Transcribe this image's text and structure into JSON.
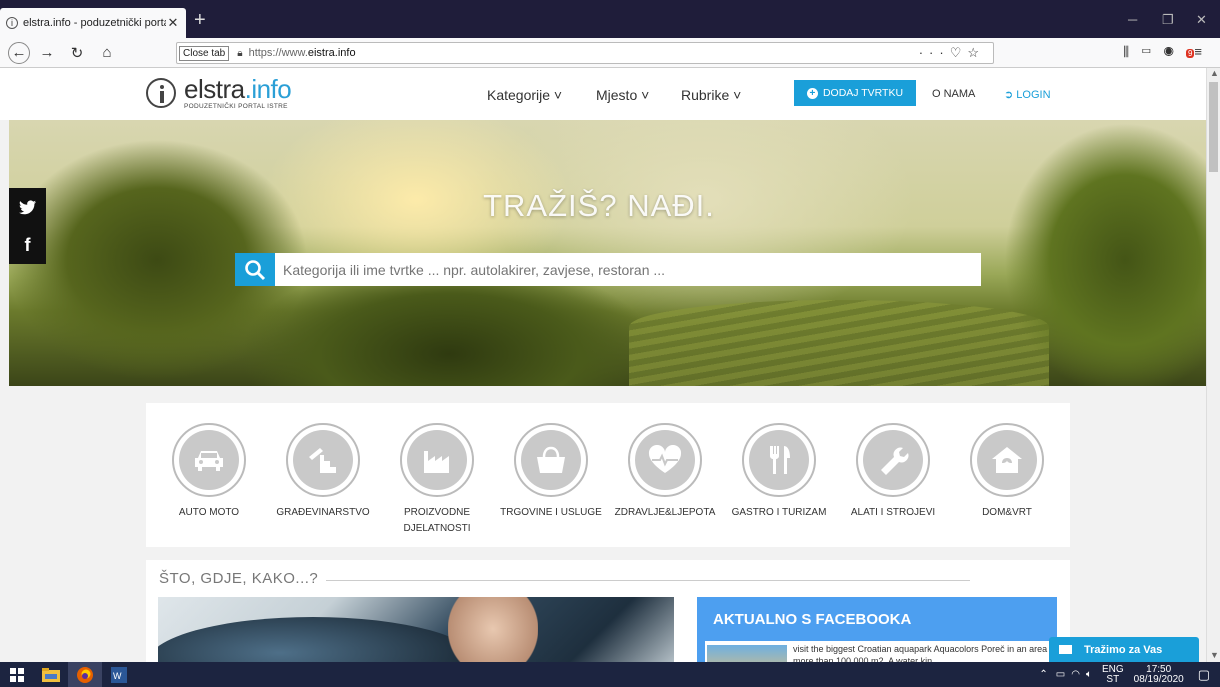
{
  "browser": {
    "tab_title": "elstra.info - poduzetnički porta",
    "tab_close_tooltip": "Close tab",
    "url_prefix": "https://www.",
    "url_domain": "eistra.info",
    "url_menu_glyph": "···",
    "new_tab_glyph": "+"
  },
  "site": {
    "logo_name": "elstra",
    "logo_tld": "info",
    "logo_subtitle": "PODUZETNIČKI PORTAL ISTRE",
    "nav": [
      {
        "label": "Kategorije ˅"
      },
      {
        "label": "Mjesto ˅"
      },
      {
        "label": "Rubrike ˅"
      }
    ],
    "add_business": "DODAJ TVRTKU",
    "about": "O NAMA",
    "login": "LOGIN"
  },
  "hero": {
    "title": "TRAŽIŠ? NAĐI.",
    "search_placeholder": "Kategorija ili ime tvrtke ... npr. autolakirer, zavjese, restoran ..."
  },
  "social": {
    "twitter": "twitter-icon",
    "facebook": "facebook-icon"
  },
  "categories": [
    {
      "label": "AUTO MOTO",
      "icon": "car-icon"
    },
    {
      "label": "GRAĐEVINARSTVO",
      "icon": "construction-icon"
    },
    {
      "label": "PROIZVODNE DJELATNOSTI",
      "icon": "factory-icon"
    },
    {
      "label": "TRGOVINE I USLUGE",
      "icon": "shopping-basket-icon"
    },
    {
      "label": "ZDRAVLJE&LJEPOTA",
      "icon": "heart-icon"
    },
    {
      "label": "GASTRO I TURIZAM",
      "icon": "cutlery-icon"
    },
    {
      "label": "ALATI I STROJEVI",
      "icon": "wrench-icon"
    },
    {
      "label": "DOM&VRT",
      "icon": "house-icon"
    }
  ],
  "section": {
    "title": "ŠTO, GDJE, KAKO...?",
    "facebook_title": "AKTUALNO S FACEBOOKA",
    "facebook_post": "visit the biggest Croatian aquapark Aquacolors Poreč in an area more than 100.000 m2. A water kin..."
  },
  "chat": {
    "label": "Tražimo za Vas"
  },
  "taskbar": {
    "lang_top": "ENG",
    "lang_bottom": "ST",
    "time": "17:50",
    "date": "08/19/2020"
  },
  "colors": {
    "accent": "#1a9fd9",
    "facebook": "#4d9ff0"
  }
}
